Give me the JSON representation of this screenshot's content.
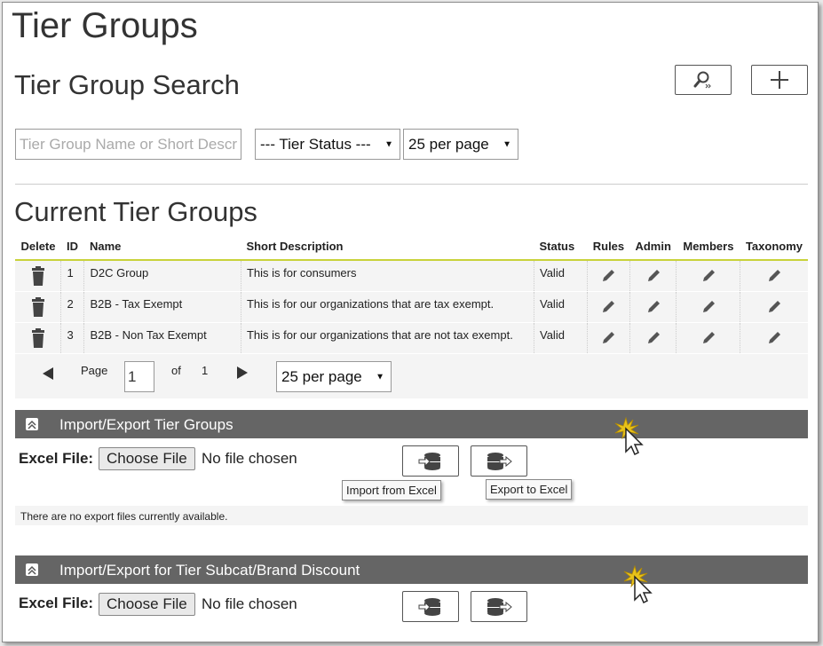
{
  "page_title": "Tier Groups",
  "search": {
    "title": "Tier Group Search",
    "name_placeholder": "Tier Group Name or Short Descr",
    "status_select": "--- Tier Status ---",
    "per_page_select": "25 per page"
  },
  "current": {
    "title": "Current Tier Groups",
    "columns": [
      "Delete",
      "ID",
      "Name",
      "Short Description",
      "Status",
      "Rules",
      "Admin",
      "Members",
      "Taxonomy"
    ],
    "rows": [
      {
        "id": "1",
        "name": "D2C Group",
        "desc": "This is for consumers",
        "status": "Valid"
      },
      {
        "id": "2",
        "name": "B2B - Tax Exempt",
        "desc": "This is for our organizations that are tax exempt.",
        "status": "Valid"
      },
      {
        "id": "3",
        "name": "B2B - Non Tax Exempt",
        "desc": "This is for our organizations that are not tax exempt.",
        "status": "Valid"
      }
    ],
    "pager": {
      "page_label": "Page",
      "page_value": "1",
      "of_label": "of",
      "total_pages": "1",
      "per_page": "25 per page"
    }
  },
  "import_export_1": {
    "title": "Import/Export Tier Groups",
    "excel_label": "Excel File:",
    "choose_file": "Choose File",
    "no_file": "No file chosen",
    "import_tooltip": "Import from Excel",
    "export_tooltip": "Export to Excel",
    "no_exports": "There are no export files currently available."
  },
  "import_export_2": {
    "title": "Import/Export for Tier Subcat/Brand Discount",
    "excel_label": "Excel File:",
    "choose_file": "Choose File",
    "no_file": "No file chosen"
  },
  "colors": {
    "accent_line": "#c8d23a",
    "section_bar": "#656565",
    "row_bg": "#f4f4f4"
  }
}
